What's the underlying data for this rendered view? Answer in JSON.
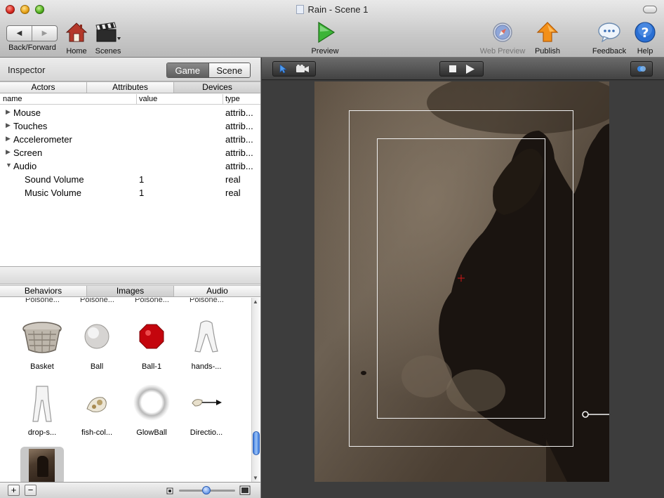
{
  "window": {
    "title": "Rain - Scene 1"
  },
  "toolbar": {
    "back_forward_label": "Back/Forward",
    "home_label": "Home",
    "scenes_label": "Scenes",
    "preview_label": "Preview",
    "web_preview_label": "Web Preview",
    "publish_label": "Publish",
    "feedback_label": "Feedback",
    "help_label": "Help"
  },
  "inspector": {
    "title": "Inspector",
    "scope_tabs": [
      "Game",
      "Scene"
    ],
    "active_scope": "Game",
    "tabs": [
      "Actors",
      "Attributes",
      "Devices"
    ],
    "active_tab": "Devices",
    "columns": [
      "name",
      "value",
      "type"
    ],
    "rows": [
      {
        "name": "Mouse",
        "value": "",
        "type": "attrib...",
        "expanded": false
      },
      {
        "name": "Touches",
        "value": "",
        "type": "attrib...",
        "expanded": false
      },
      {
        "name": "Accelerometer",
        "value": "",
        "type": "attrib...",
        "expanded": false
      },
      {
        "name": "Screen",
        "value": "",
        "type": "attrib...",
        "expanded": false
      },
      {
        "name": "Audio",
        "value": "",
        "type": "attrib...",
        "expanded": true
      },
      {
        "name": "Sound Volume",
        "value": "1",
        "type": "real",
        "child": true
      },
      {
        "name": "Music Volume",
        "value": "1",
        "type": "real",
        "child": true
      }
    ]
  },
  "library": {
    "tabs": [
      "Behaviors",
      "Images",
      "Audio"
    ],
    "active_tab": "Images",
    "cut_off_labels": [
      "Poisone...",
      "Poisone...",
      "Poisone...",
      "Poisone..."
    ],
    "items": [
      {
        "label": "Basket",
        "icon": "basket-thumbnail"
      },
      {
        "label": "Ball",
        "icon": "ball-thumbnail"
      },
      {
        "label": "Ball-1",
        "icon": "red-ball-thumbnail"
      },
      {
        "label": "hands-...",
        "icon": "hands-thumbnail"
      },
      {
        "label": "drop-s...",
        "icon": "drop-thumbnail"
      },
      {
        "label": "fish-col...",
        "icon": "fish-thumbnail"
      },
      {
        "label": "GlowBall",
        "icon": "glowball-thumbnail"
      },
      {
        "label": "Directio...",
        "icon": "direction-thumbnail"
      },
      {
        "label": "",
        "icon": "painting-thumbnail"
      }
    ],
    "footer": {
      "add": "+",
      "remove": "−"
    }
  },
  "colors": {
    "accent_blue": "#3b78dd",
    "preview_green": "#2fa52a",
    "publish_orange": "#f08a12",
    "help_blue": "#1f63c9"
  }
}
